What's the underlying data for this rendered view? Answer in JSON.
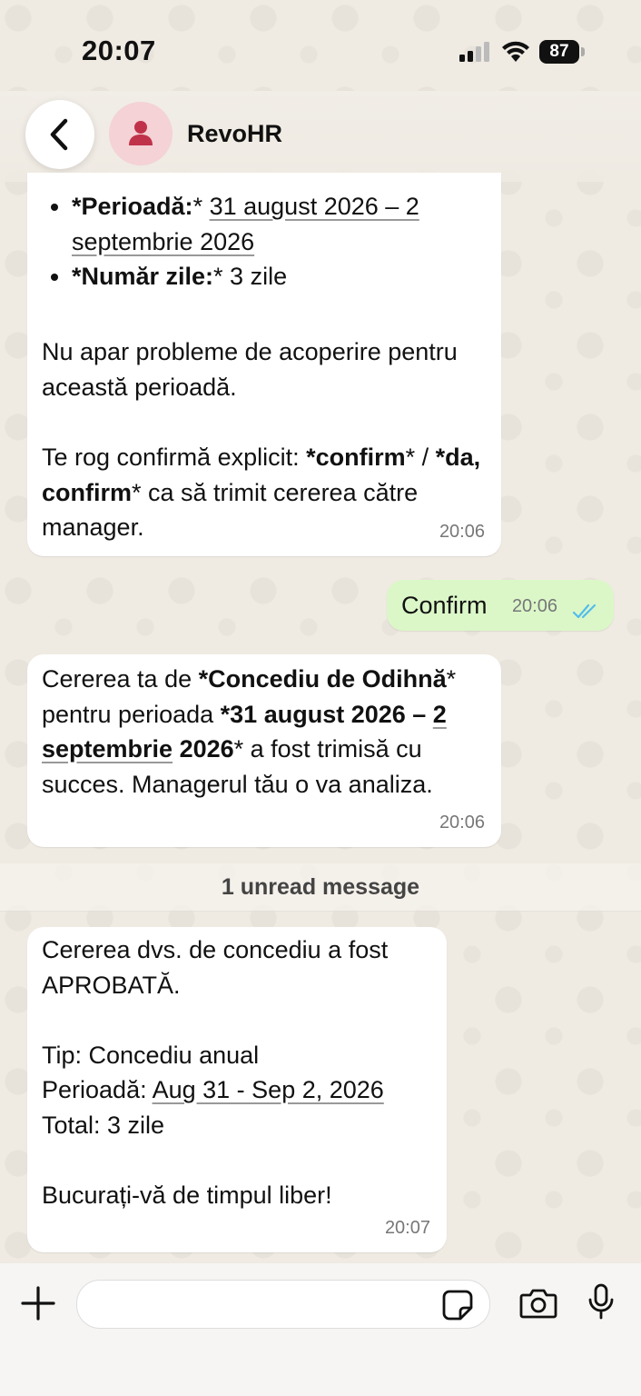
{
  "status_bar": {
    "time": "20:07",
    "battery": "87"
  },
  "header": {
    "contact_name": "RevoHR"
  },
  "messages": {
    "m1": {
      "bullet1_label": "*Perioadă:",
      "bullet1_star": "*",
      "bullet1_value_a": "31 august 2026 – 2",
      "bullet1_value_b": "septembrie 2026",
      "bullet2_label": "*Număr zile:",
      "bullet2_rest": "* 3 zile",
      "para1": "Nu apar probleme de acoperire pentru această perioadă.",
      "para2_a": "Te rog confirmă explicit: ",
      "para2_b": "*confirm",
      "para2_c": "* / ",
      "para2_d": "*da, confirm",
      "para2_e": "* ca să trimit cererea către manager.",
      "time": "20:06"
    },
    "m2": {
      "text": "Confirm",
      "time": "20:06"
    },
    "m3": {
      "t1": "Cererea ta de ",
      "t2": "*Concediu de Odihnă",
      "t3": "* pentru perioada ",
      "t4": "*31 august 2026 – ",
      "t5": "2 septembrie",
      "t6": " 2026",
      "t7": "* a fost trimisă cu succes. Managerul tău o va analiza.",
      "time": "20:06"
    },
    "unread_label": "1 unread message",
    "m4": {
      "line1": "Cererea dvs. de concediu a fost APROBATĂ.",
      "tip": "Tip: Concediu anual",
      "period_label": "Perioadă: ",
      "period_value": "Aug 31 - Sep 2, 2026",
      "total": "Total: 3 zile",
      "closing": "Bucurați-vă de timpul liber!",
      "time": "20:07"
    }
  },
  "icons": {
    "back": "chevron-left-icon",
    "avatar": "person-icon",
    "plus": "plus-icon",
    "sticker": "sticker-icon",
    "camera": "camera-icon",
    "mic": "microphone-icon",
    "read": "double-check-icon"
  },
  "colors": {
    "outgoing_bubble": "#dbf7c8",
    "read_ticks": "#53bdeb",
    "avatar_bg": "#f4d2d6",
    "avatar_fg": "#c0324a"
  }
}
